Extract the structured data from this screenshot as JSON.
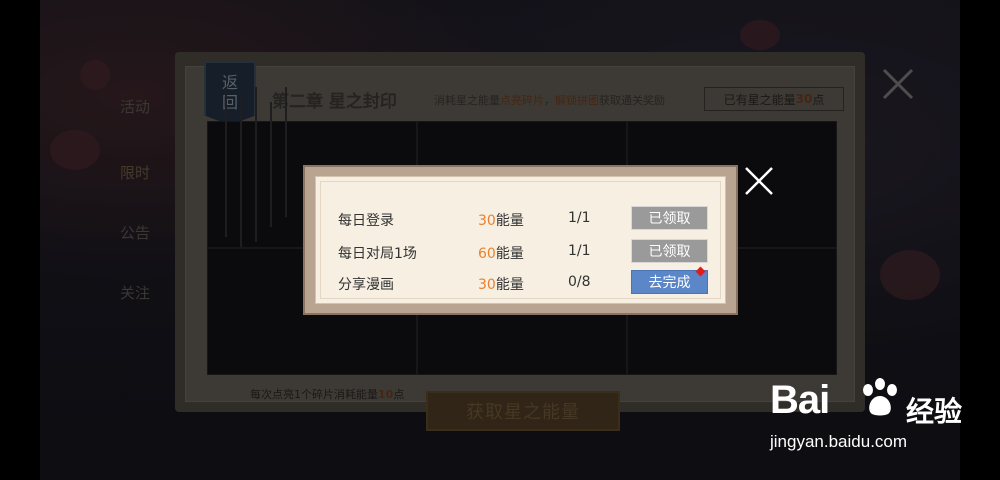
{
  "left_menu": [
    "活动",
    "限时",
    "公告",
    "关注"
  ],
  "main": {
    "back_label_top": "返",
    "back_label_bottom": "回",
    "title": "第二章 星之封印",
    "desc_prefix": "消耗星之能量",
    "desc_hl1": "点亮碎片",
    "desc_mid": "，",
    "desc_hl2": "解锁拼图",
    "desc_suffix": "获取通关奖励",
    "owned_prefix": "已有星之能量",
    "owned_value": "30",
    "owned_suffix": "点",
    "bottom_prefix": "每次点亮1个碎片消耗能量",
    "bottom_value": "10",
    "bottom_suffix": "点",
    "get_energy_label": "获取星之能量"
  },
  "dialog": {
    "energy_unit": "能量",
    "tasks": [
      {
        "name": "每日登录",
        "reward": "30",
        "progress": "1/1",
        "button": "已领取",
        "state": "claimed"
      },
      {
        "name": "每日对局1场",
        "reward": "60",
        "progress": "1/1",
        "button": "已领取",
        "state": "claimed"
      },
      {
        "name": "分享漫画",
        "reward": "30",
        "progress": "0/8",
        "button": "去完成",
        "state": "go"
      }
    ]
  },
  "watermark": {
    "brand": "Bai",
    "brand_suffix": "du",
    "cn": "经验",
    "url": "jingyan.baidu.com"
  },
  "colors": {
    "accent_orange": "#e8822e",
    "claimed_gray": "#9a9a9a",
    "go_blue": "#5b86c8",
    "notify_red": "#e31b1b"
  },
  "icons": [
    "close-icon",
    "paw-icon"
  ]
}
